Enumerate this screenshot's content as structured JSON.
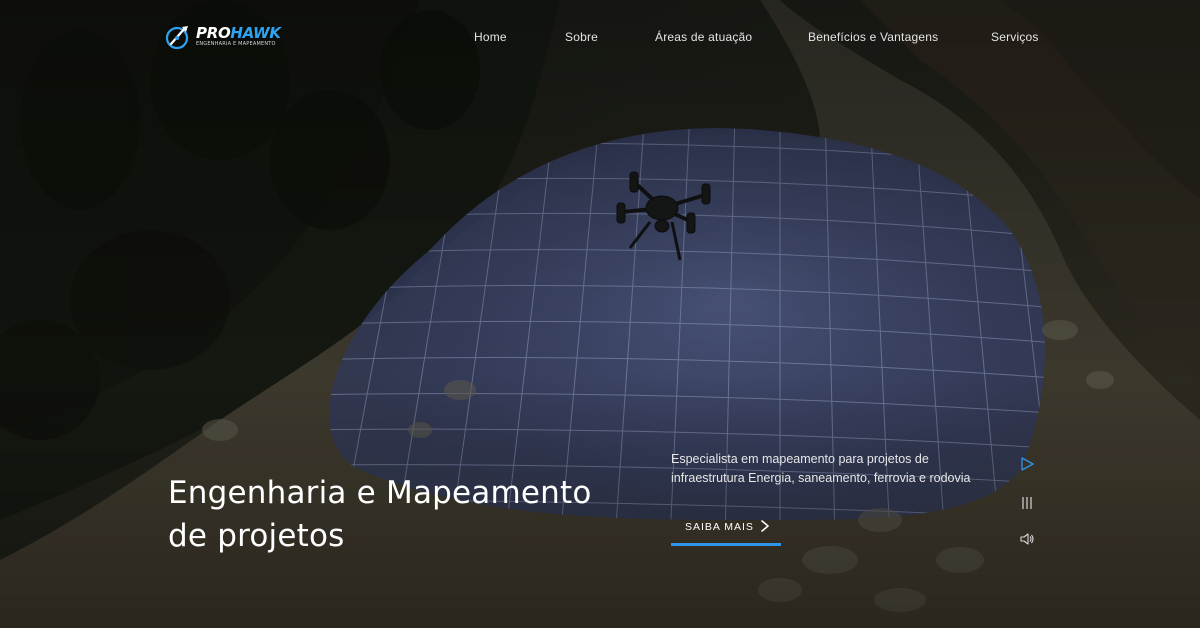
{
  "brand": {
    "name_part1": "PRO",
    "name_part2": "HAWK",
    "tagline": "ENGENHARIA E MAPEAMENTO",
    "accent": "#2ea3f2",
    "icon": "compass-globe-icon"
  },
  "nav": {
    "items": [
      {
        "label": "Home"
      },
      {
        "label": "Sobre"
      },
      {
        "label": "Áreas de atuação"
      },
      {
        "label": "Benefícios e Vantagens"
      },
      {
        "label": "Serviços"
      }
    ]
  },
  "hero": {
    "headline_line1": "Engenharia e Mapeamento",
    "headline_line2": "de projetos",
    "description": "Especialista em mapeamento para projetos de infraestrutura Energia, saneamento, ferrovia e rodovia",
    "cta_label": "SAIBA MAIS",
    "cta_icon": "chevron-right-icon",
    "cta_underline_color": "#2e95ea"
  },
  "media_controls": {
    "play_icon": "play-icon",
    "pause_icon": "pause-icon",
    "volume_icon": "volume-icon",
    "play_color": "#2e95ea"
  }
}
